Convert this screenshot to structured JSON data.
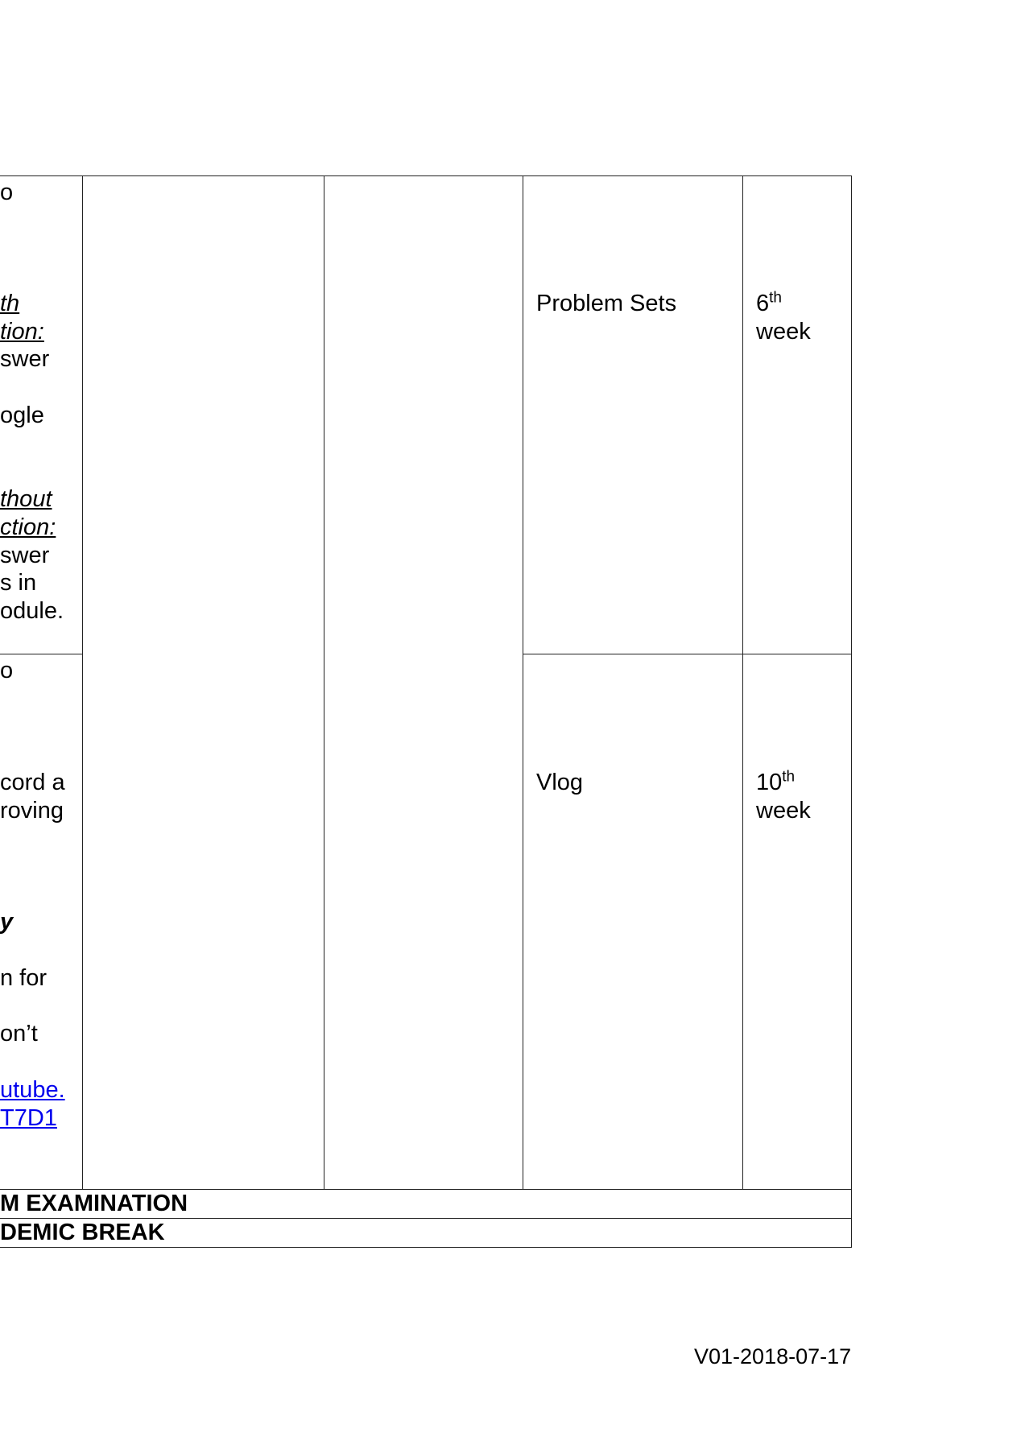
{
  "table": {
    "row1": {
      "col1_lines": [
        "o",
        "th",
        "tion:",
        "swer",
        "ogle",
        "thout",
        "ction:",
        "swer",
        "s in",
        "odule."
      ],
      "activity": "Problem Sets",
      "week_num": "6",
      "week_sup": "th",
      "week_word": "week"
    },
    "row2": {
      "col1_lines": [
        "o",
        "cord a",
        "roving",
        "y",
        "n for",
        "on’t",
        "utube.",
        "T7D1"
      ],
      "activity": "Vlog",
      "week_num": "10",
      "week_sup": "th",
      "week_word": "week"
    },
    "midterm_label": "M EXAMINATION",
    "break_label": "DEMIC BREAK"
  },
  "footer": {
    "version": "V01-2018-07-17"
  }
}
